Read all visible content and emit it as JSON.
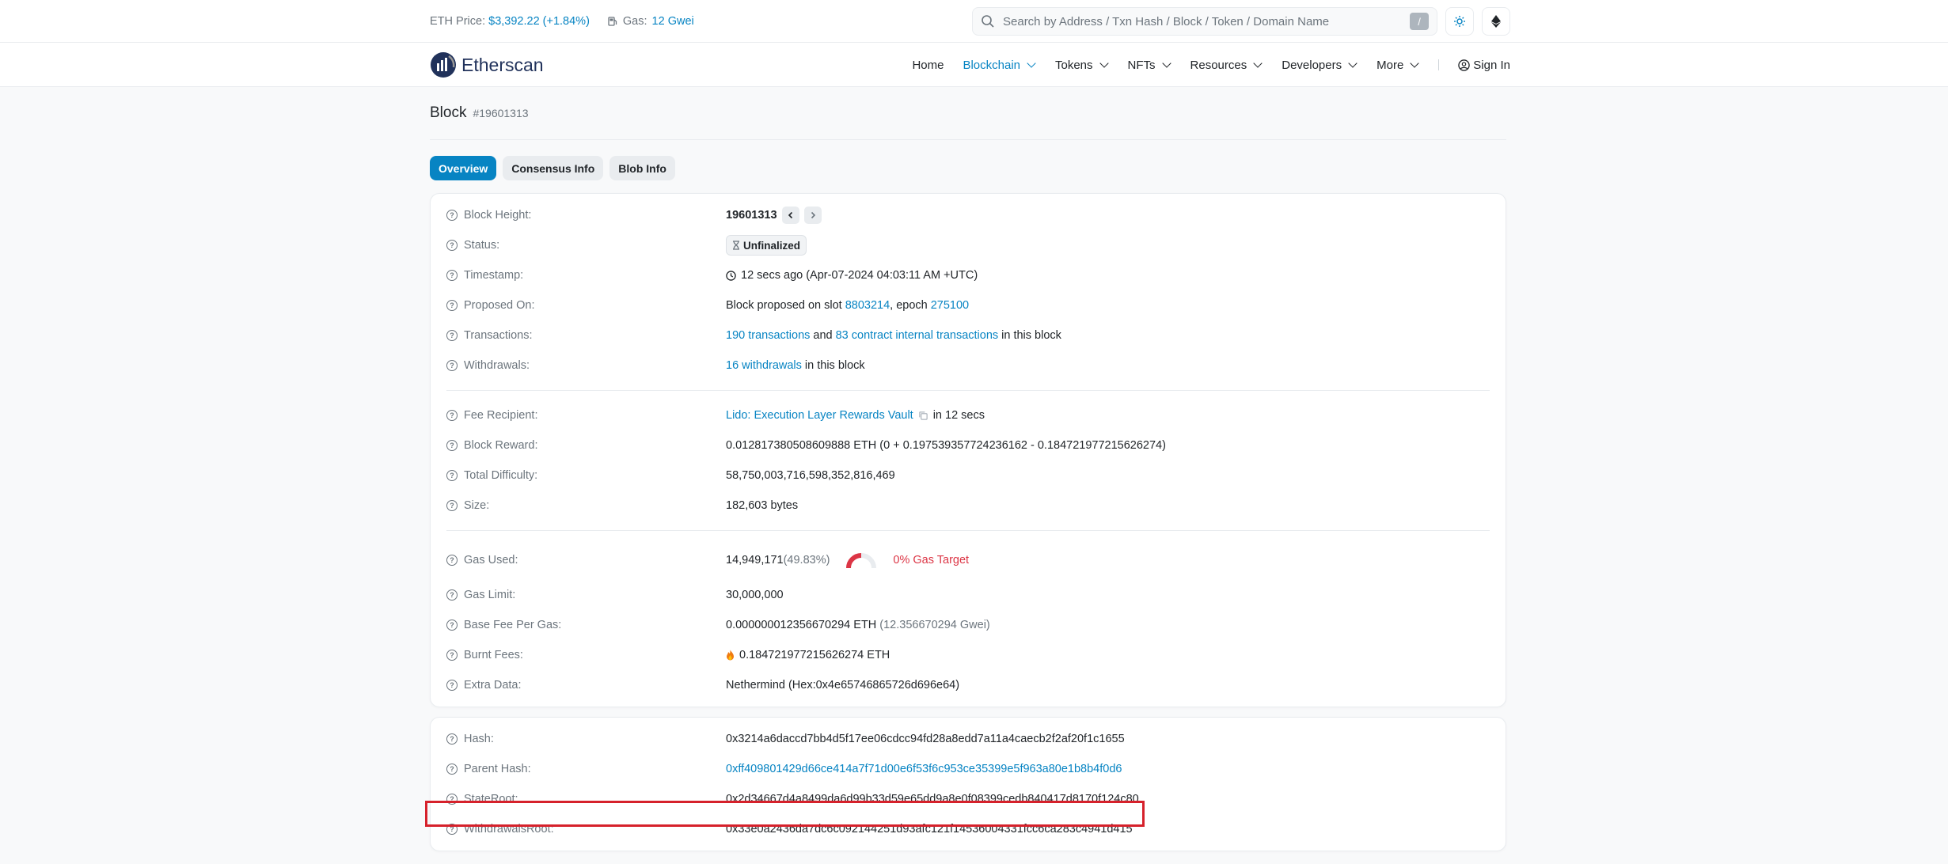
{
  "topbar": {
    "eth_price_label": "ETH Price:",
    "eth_price_value": "$3,392.22 (+1.84%)",
    "gas_label": "Gas:",
    "gas_value": "12 Gwei",
    "search_placeholder": "Search by Address / Txn Hash / Block / Token / Domain Name",
    "search_shortcut": "/"
  },
  "nav": {
    "logo_text": "Etherscan",
    "items": [
      {
        "label": "Home"
      },
      {
        "label": "Blockchain"
      },
      {
        "label": "Tokens"
      },
      {
        "label": "NFTs"
      },
      {
        "label": "Resources"
      },
      {
        "label": "Developers"
      },
      {
        "label": "More"
      }
    ],
    "sign_in": "Sign In"
  },
  "page": {
    "title": "Block",
    "block_number": "#19601313",
    "tabs": [
      {
        "label": "Overview",
        "active": true
      },
      {
        "label": "Consensus Info",
        "active": false
      },
      {
        "label": "Blob Info",
        "active": false
      }
    ]
  },
  "overview": {
    "block_height_label": "Block Height:",
    "block_height_value": "19601313",
    "status_label": "Status:",
    "status_value": "Unfinalized",
    "timestamp_label": "Timestamp:",
    "timestamp_value": "12 secs ago (Apr-07-2024 04:03:11 AM +UTC)",
    "proposed_label": "Proposed On:",
    "proposed_prefix": "Block proposed on slot",
    "proposed_slot": "8803214",
    "proposed_mid": ", epoch",
    "proposed_epoch": "275100",
    "transactions_label": "Transactions:",
    "transactions_link": "190 transactions",
    "transactions_mid": "and",
    "internal_link": "83 contract internal transactions",
    "transactions_suffix": "in this block",
    "withdrawals_label": "Withdrawals:",
    "withdrawals_link": "16 withdrawals",
    "withdrawals_suffix": "in this block",
    "fee_recipient_label": "Fee Recipient:",
    "fee_recipient_link": "Lido: Execution Layer Rewards Vault",
    "fee_recipient_suffix": "in 12 secs",
    "block_reward_label": "Block Reward:",
    "block_reward_value": "0.012817380508609888 ETH (0 + 0.197539357724236162 - 0.184721977215626274)",
    "total_difficulty_label": "Total Difficulty:",
    "total_difficulty_value": "58,750,003,716,598,352,816,469",
    "size_label": "Size:",
    "size_value": "182,603 bytes",
    "gas_used_label": "Gas Used:",
    "gas_used_value": "14,949,171",
    "gas_used_pct": "(49.83%)",
    "gas_target": "0% Gas Target",
    "gas_limit_label": "Gas Limit:",
    "gas_limit_value": "30,000,000",
    "base_fee_label": "Base Fee Per Gas:",
    "base_fee_value": "0.000000012356670294 ETH",
    "base_fee_gwei": "(12.356670294 Gwei)",
    "burnt_fees_label": "Burnt Fees:",
    "burnt_fees_value": "0.184721977215626274 ETH",
    "extra_data_label": "Extra Data:",
    "extra_data_value": "Nethermind (Hex:0x4e65746865726d696e64)"
  },
  "hashes": {
    "hash_label": "Hash:",
    "hash_value": "0x3214a6daccd7bb4d5f17ee06cdcc94fd28a8edd7a11a4caecb2f2af20f1c1655",
    "parent_hash_label": "Parent Hash:",
    "parent_hash_value": "0xff409801429d66ce414a7f71d00e6f53f6c953ce35399e5f963a80e1b8b4f0d6",
    "state_root_label": "StateRoot:",
    "state_root_value": "0x2d34667d4a8499da6d99b33d59e65dd9a8e0f08399cedb840417d8170f124c80",
    "withdrawals_root_label": "WithdrawalsRoot:",
    "withdrawals_root_value": "0x33e0a2436da7dc6c092144251d93afc121f14536004331fcc6ca283c4941d415"
  },
  "colors": {
    "accent": "#0784c3",
    "highlight": "#d6212b",
    "gas_target": "#dc3545"
  }
}
